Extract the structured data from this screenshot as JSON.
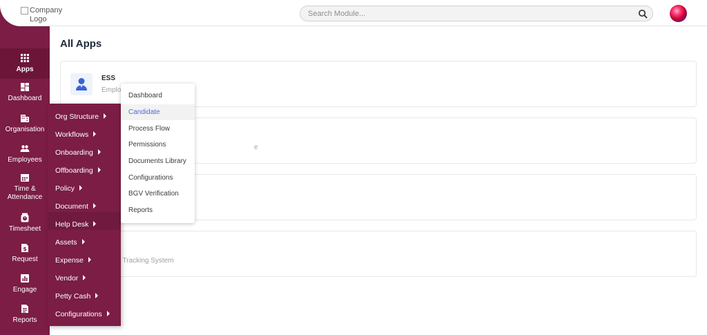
{
  "header": {
    "logo_alt": "Company Logo",
    "search_placeholder": "Search Module..."
  },
  "sidebar": {
    "items": [
      {
        "label": "Apps",
        "icon": "grid-icon",
        "active": true
      },
      {
        "label": "Dashboard",
        "icon": "dashboard-icon"
      },
      {
        "label": "Organisation",
        "icon": "building-icon"
      },
      {
        "label": "Employees",
        "icon": "people-icon"
      },
      {
        "label": "Time &",
        "label2": "Attendance",
        "icon": "calendar-icon"
      },
      {
        "label": "Timesheet",
        "icon": "timer-icon"
      },
      {
        "label": "Request",
        "icon": "dollar-doc-icon"
      },
      {
        "label": "Engage",
        "icon": "bar-chart-icon"
      },
      {
        "label": "Reports",
        "icon": "document-icon"
      }
    ]
  },
  "main": {
    "title": "All Apps",
    "cards": [
      {
        "title": "ESS",
        "sub": "Employ"
      },
      {
        "title": "",
        "sub": "e"
      },
      {
        "title": "",
        "sub": ""
      },
      {
        "title": "",
        "sub": "ant Tracking System"
      }
    ]
  },
  "org_menu": {
    "items": [
      "Org Structure",
      "Workflows",
      "Onboarding",
      "Offboarding",
      "Policy",
      "Document",
      "Help Desk",
      "Assets",
      "Expense",
      "Vendor",
      "Petty Cash",
      "Configurations"
    ]
  },
  "onboarding_menu": {
    "items": [
      "Dashboard",
      "Candidate",
      "Process Flow",
      "Permissions",
      "Documents Library",
      "Configurations",
      "BGV Verification",
      "Reports"
    ],
    "active": "Candidate"
  },
  "colors": {
    "sidebar": "#7b1d45",
    "accent": "#4a6bdc"
  }
}
